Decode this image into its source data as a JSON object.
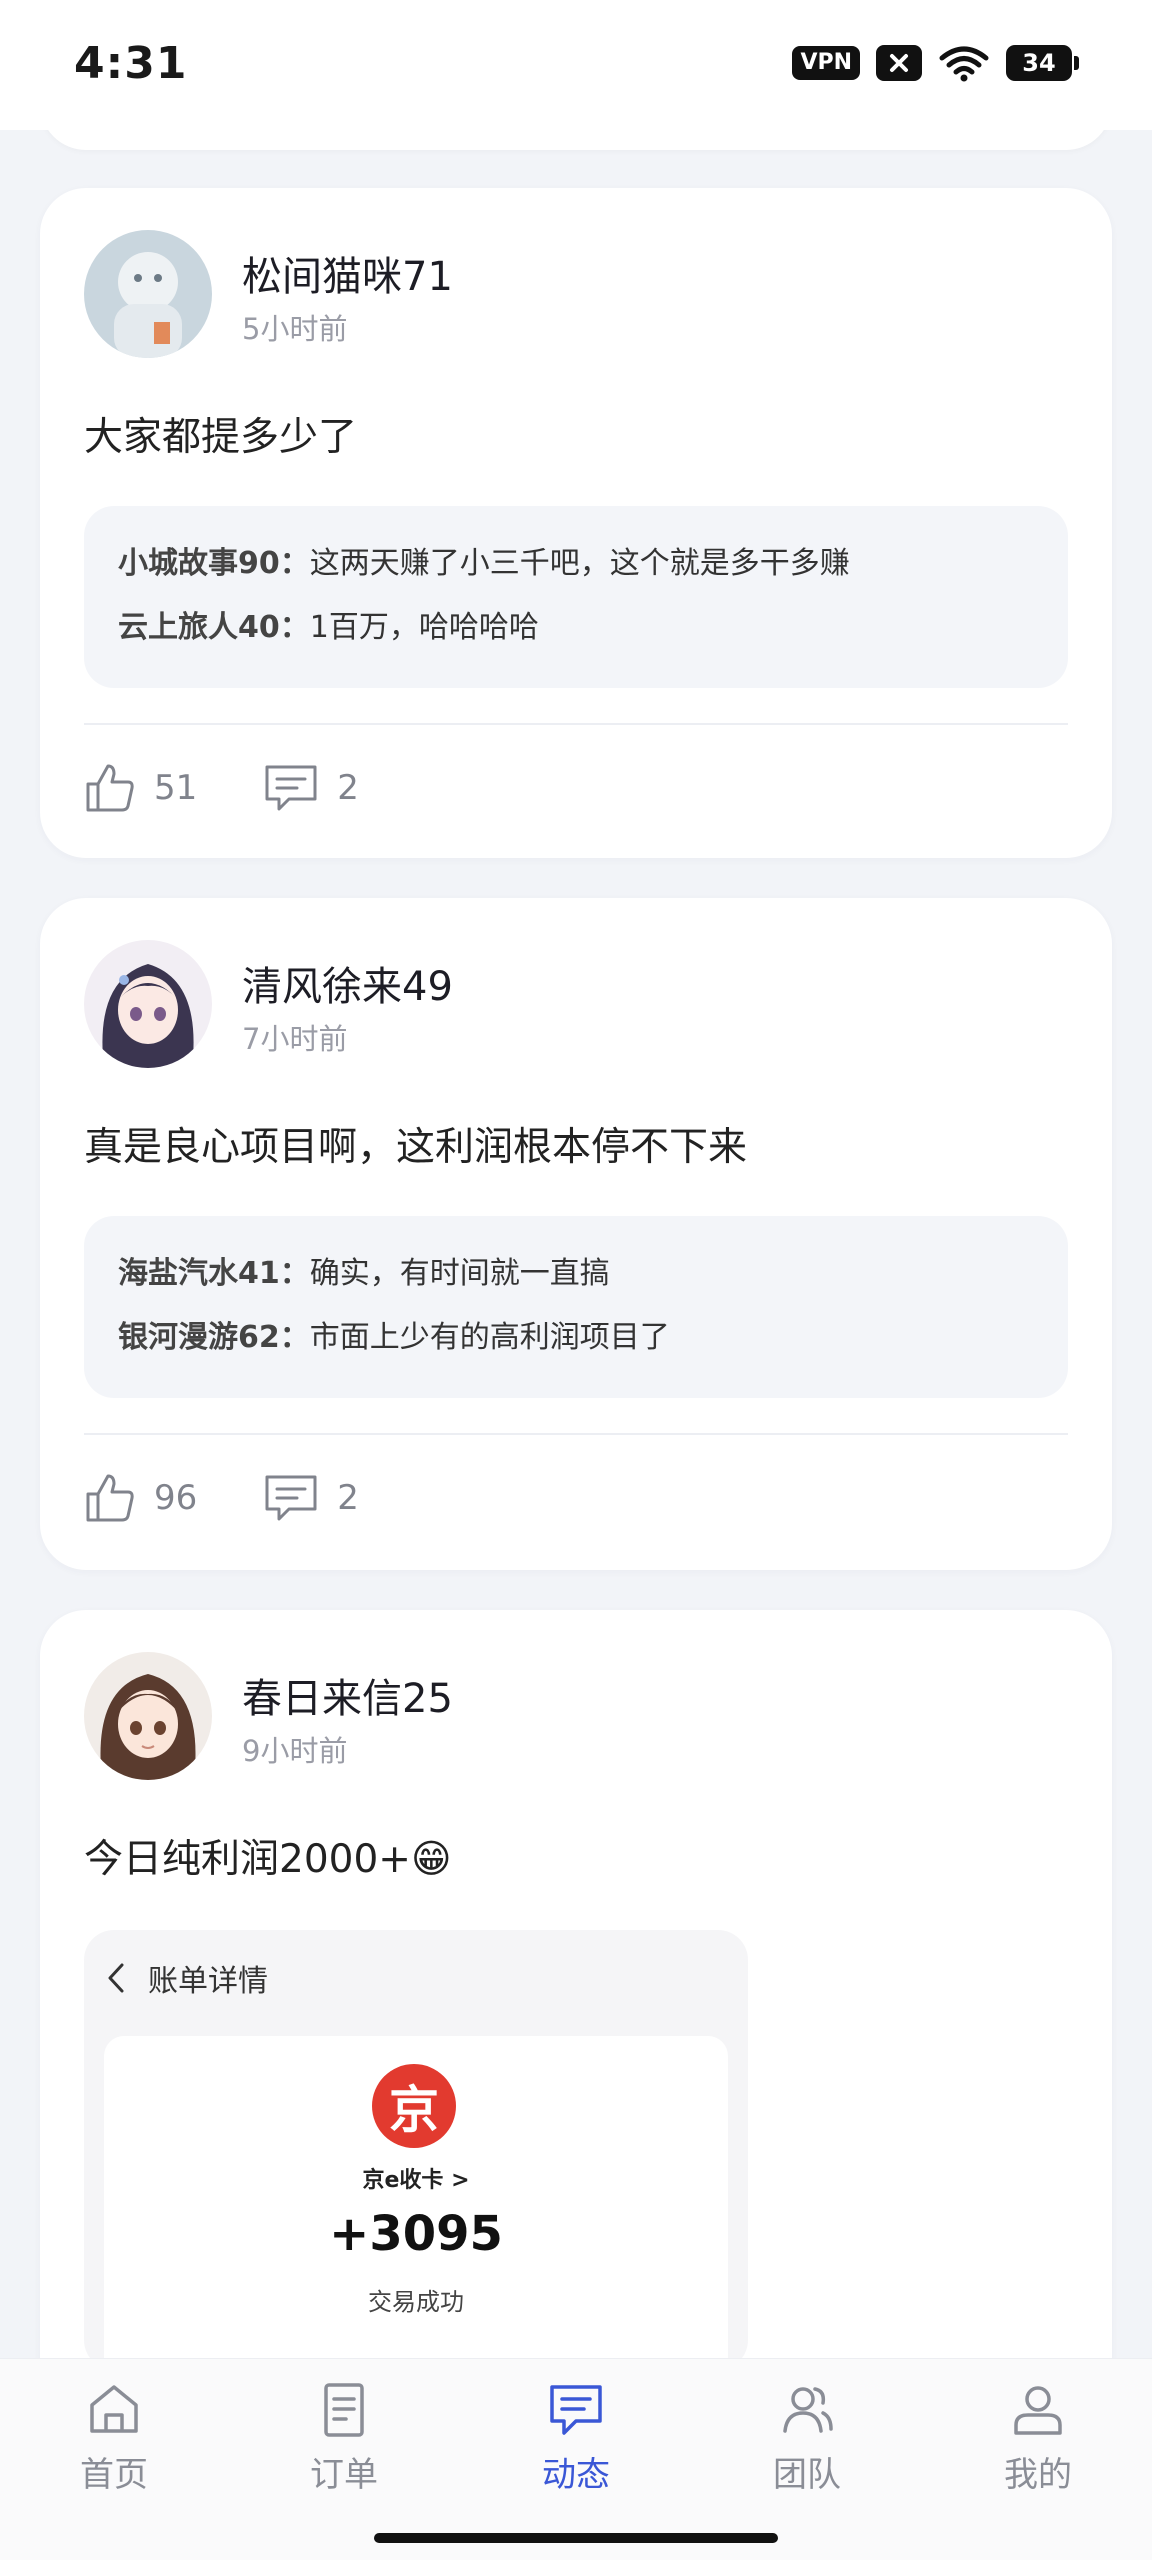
{
  "status_bar": {
    "time": "4:31",
    "vpn_label": "VPN",
    "battery": "34"
  },
  "posts": [
    {
      "username": "松间猫咪71",
      "time": "5小时前",
      "text": "大家都提多少了",
      "comments": [
        {
          "author": "小城故事90：",
          "text": "这两天赚了小三千吧，这个就是多干多赚"
        },
        {
          "author": "云上旅人40：",
          "text": "1百万，哈哈哈哈"
        }
      ],
      "likes": "51",
      "comment_count": "2"
    },
    {
      "username": "清风徐来49",
      "time": "7小时前",
      "text": "真是良心项目啊，这利润根本停不下来",
      "comments": [
        {
          "author": "海盐汽水41：",
          "text": "确实，有时间就一直搞"
        },
        {
          "author": "银河漫游62：",
          "text": "市面上少有的高利润项目了"
        }
      ],
      "likes": "96",
      "comment_count": "2"
    },
    {
      "username": "春日来信25",
      "time": "9小时前",
      "text": "今日纯利润2000+😁",
      "screenshot": {
        "header": "账单详情",
        "logo_char": "京",
        "merchant": "京e收卡 >",
        "amount": "+3095",
        "status": "交易成功"
      }
    }
  ],
  "nav": {
    "items": [
      {
        "label": "首页",
        "icon": "home-icon"
      },
      {
        "label": "订单",
        "icon": "order-icon"
      },
      {
        "label": "动态",
        "icon": "feed-icon"
      },
      {
        "label": "团队",
        "icon": "team-icon"
      },
      {
        "label": "我的",
        "icon": "profile-icon"
      }
    ],
    "active": "动态",
    "active_color": "#3a57d6",
    "inactive_color": "#8a8d96"
  }
}
